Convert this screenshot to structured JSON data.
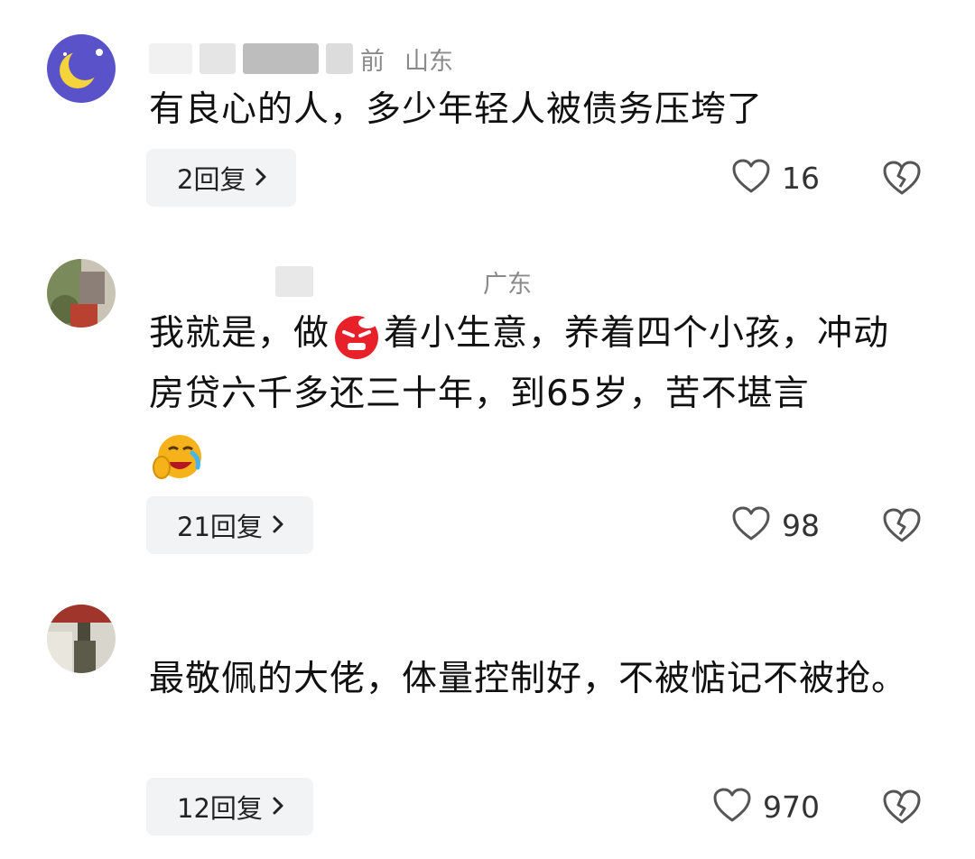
{
  "comments": [
    {
      "meta_time": "前",
      "meta_location": "山东",
      "text": "有良心的人，多少年轻人被债务压垮了",
      "reply_label": "2回复",
      "likes": "16"
    },
    {
      "meta_time": "",
      "meta_location": "广东",
      "text_before_emoji": "我就是，做",
      "text_after_emoji": "着小生意，养着四个小孩，冲动房贷六千多还三十年，到65岁，苦不堪言",
      "inline_emoji": "angry-face-emoji",
      "trailing_emoji": "laughing-crying-emoji",
      "reply_label": "21回复",
      "likes": "98"
    },
    {
      "meta_time": "",
      "meta_location": "",
      "text": "最敬佩的大佬，体量控制好，不被惦记不被抢。",
      "reply_label": "12回复",
      "likes": "970"
    }
  ],
  "icons": {
    "like": "heart-outline-icon",
    "dislike": "broken-heart-icon",
    "chevron": "chevron-right-icon"
  },
  "colors": {
    "text": "#111111",
    "meta": "#9a9a9a",
    "reply_bg": "#f2f3f5",
    "icon": "#555555"
  }
}
